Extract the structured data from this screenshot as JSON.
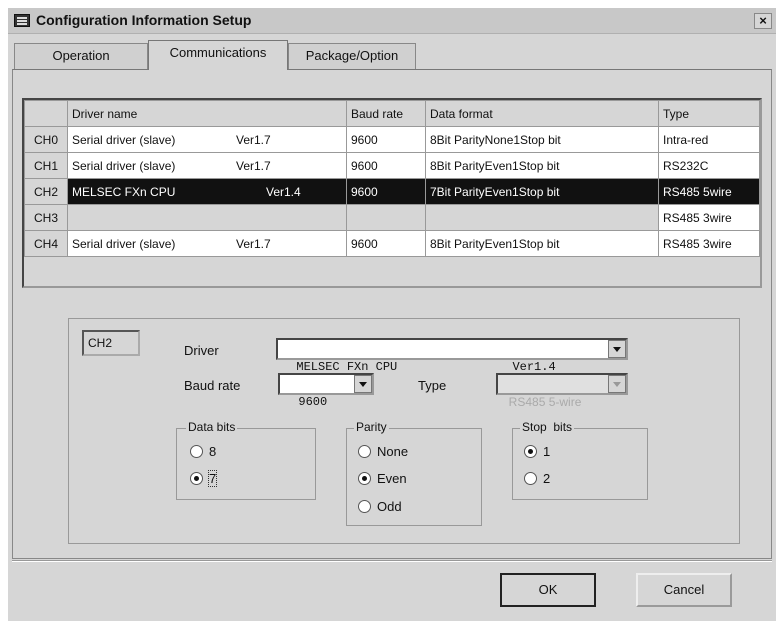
{
  "window": {
    "title": "Configuration Information Setup",
    "close_glyph": "×"
  },
  "tabs": [
    {
      "label": "Operation",
      "active": false
    },
    {
      "label": "Communications",
      "active": true
    },
    {
      "label": "Package/Option",
      "active": false
    }
  ],
  "grid": {
    "headers": [
      "Driver name",
      "Baud rate",
      "Data format",
      "Type"
    ],
    "rows": [
      {
        "ch": "CH0",
        "driver": "Serial driver (slave)",
        "ver": "Ver1.7",
        "baud": "9600",
        "format": "8Bit ParityNone1Stop bit",
        "type": "Intra-red"
      },
      {
        "ch": "CH1",
        "driver": "Serial driver (slave)",
        "ver": "Ver1.7",
        "baud": "9600",
        "format": "8Bit ParityEven1Stop bit",
        "type": "RS232C"
      },
      {
        "ch": "CH2",
        "driver": "MELSEC FXn CPU",
        "ver": "Ver1.4",
        "baud": "9600",
        "format": "7Bit ParityEven1Stop bit",
        "type": "RS485 5wire"
      },
      {
        "ch": "CH3",
        "driver": "",
        "ver": "",
        "baud": "",
        "format": "",
        "type": "RS485 3wire"
      },
      {
        "ch": "CH4",
        "driver": "Serial driver (slave)",
        "ver": "Ver1.7",
        "baud": "9600",
        "format": "8Bit ParityEven1Stop bit",
        "type": "RS485 3wire"
      }
    ]
  },
  "detail": {
    "channel": "CH2",
    "driver_label": "Driver",
    "driver_value": "MELSEC FXn CPU                Ver1.4",
    "baud_label": "Baud rate",
    "baud_value": "9600",
    "type_label": "Type",
    "type_value": "RS485 5-wire",
    "data_bits": {
      "legend": "Data bits",
      "options": [
        "8",
        "7"
      ],
      "selected": "7"
    },
    "parity": {
      "legend": "Parity",
      "options": [
        "None",
        "Even",
        "Odd"
      ],
      "selected": "Even"
    },
    "stop_bits": {
      "legend": "Stop  bits",
      "options": [
        "1",
        "2"
      ],
      "selected": "1"
    }
  },
  "buttons": {
    "ok": "OK",
    "cancel": "Cancel"
  }
}
